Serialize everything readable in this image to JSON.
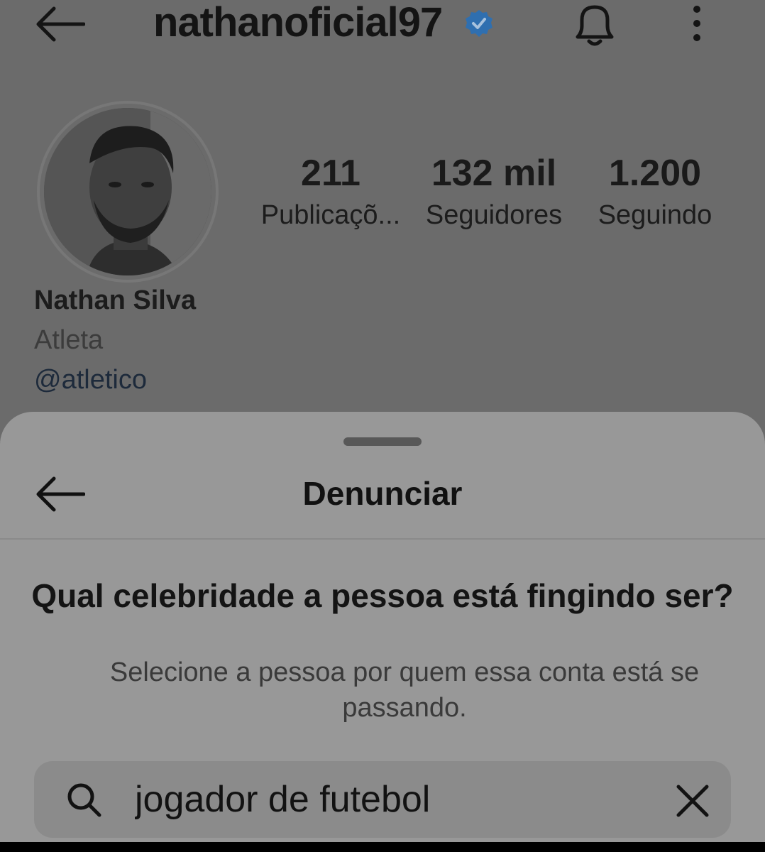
{
  "header": {
    "username": "nathanoficial97",
    "icons": [
      "back-arrow-icon",
      "verified-badge-icon",
      "bell-icon",
      "more-vertical-icon"
    ]
  },
  "profile": {
    "stats": [
      {
        "value": "211",
        "label": "Publicaçõ..."
      },
      {
        "value": "132 mil",
        "label": "Seguidores"
      },
      {
        "value": "1.200",
        "label": "Seguindo"
      }
    ],
    "full_name": "Nathan Silva",
    "category": "Atleta",
    "mention": "@atletico"
  },
  "report_sheet": {
    "title": "Denunciar",
    "question": "Qual celebridade a pessoa está fingindo ser?",
    "hint": "Selecione a pessoa por quem essa conta está se passando.",
    "search": {
      "value": "jogador de futebol"
    }
  },
  "colors": {
    "verified": "#2f6fb0",
    "overlay": "#6b6b6b",
    "sheet": "#989898"
  }
}
